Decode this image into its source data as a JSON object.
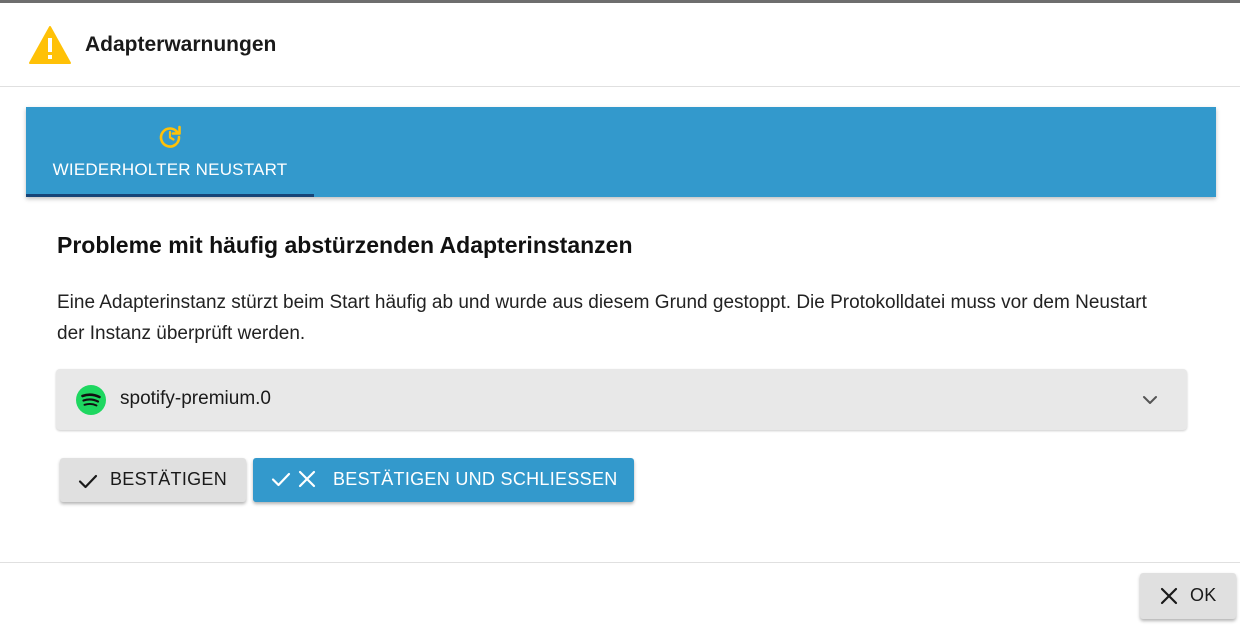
{
  "dialog": {
    "title": "Adapterwarnungen",
    "warning_icon": "warning-triangle-icon",
    "warning_color": "#ffc107"
  },
  "tabs": [
    {
      "label": "WIEDERHOLTER NEUSTART",
      "icon": "restart-icon",
      "active": true
    }
  ],
  "section": {
    "title": "Probleme mit häufig abstürzenden Adapterinstanzen",
    "description": "Eine Adapterinstanz stürzt beim Start häufig ab und wurde aus diesem Grund gestoppt. Die Protokolldatei muss vor dem Neustart der Instanz überprüft werden."
  },
  "instance": {
    "name": "spotify-premium.0",
    "icon": "spotify-icon",
    "expand_icon": "chevron-down-icon"
  },
  "actions": {
    "confirm_label": "BESTÄTIGEN",
    "confirm_close_label": "BESTÄTIGEN UND SCHLIESSEN"
  },
  "footer": {
    "ok_label": "OK"
  },
  "colors": {
    "accent": "#3399cc",
    "tab_indicator": "#164477",
    "icon_yellow": "#ffc107",
    "spotify_green": "#1ed760"
  }
}
